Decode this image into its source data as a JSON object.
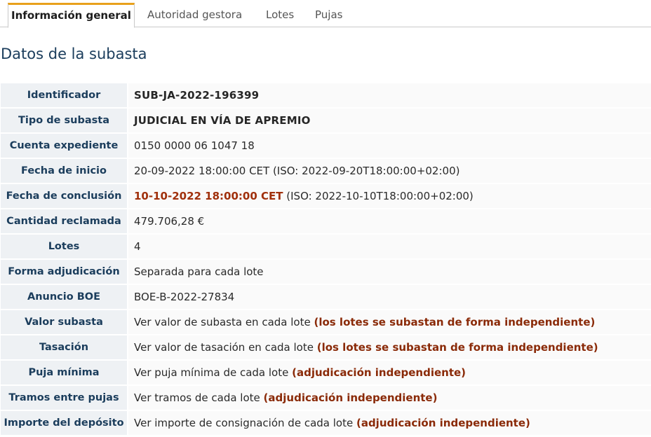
{
  "tabs": [
    {
      "label": "Información general",
      "active": true
    },
    {
      "label": "Autoridad gestora",
      "active": false
    },
    {
      "label": "Lotes",
      "active": false
    },
    {
      "label": "Pujas",
      "active": false
    }
  ],
  "section_title": "Datos de la subasta",
  "rows": {
    "identificador": {
      "label": "Identificador",
      "value": "SUB-JA-2022-196399"
    },
    "tipo": {
      "label": "Tipo de subasta",
      "value": "JUDICIAL EN VÍA DE APREMIO"
    },
    "cuenta": {
      "label": "Cuenta expediente",
      "value": "0150 0000 06 1047 18"
    },
    "inicio": {
      "label": "Fecha de inicio",
      "value": "20-09-2022 18:00:00 CET (ISO: 2022-09-20T18:00:00+02:00)"
    },
    "conclusion": {
      "label": "Fecha de conclusión",
      "date": "10-10-2022 18:00:00 CET",
      "iso": " (ISO: 2022-10-10T18:00:00+02:00)"
    },
    "cantidad": {
      "label": "Cantidad reclamada",
      "value": "479.706,28 €"
    },
    "lotes": {
      "label": "Lotes",
      "value": "4"
    },
    "forma": {
      "label": "Forma adjudicación",
      "value": "Separada para cada lote"
    },
    "anuncio": {
      "label": "Anuncio BOE",
      "value": "BOE-B-2022-27834"
    },
    "valor": {
      "label": "Valor subasta",
      "value": "Ver valor de subasta en cada lote ",
      "note": "(los lotes se subastan de forma independiente)"
    },
    "tasacion": {
      "label": "Tasación",
      "value": "Ver valor de tasación en cada lote ",
      "note": "(los lotes se subastan de forma independiente)"
    },
    "puja_minima": {
      "label": "Puja mínima",
      "value": "Ver puja mínima de cada lote ",
      "note": "(adjudicación independiente)"
    },
    "tramos": {
      "label": "Tramos entre pujas",
      "value": "Ver tramos de cada lote ",
      "note": "(adjudicación independiente)"
    },
    "deposito": {
      "label": "Importe del depósito",
      "value": "Ver importe de consignación de cada lote ",
      "note": "(adjudicación independiente)"
    }
  },
  "colors": {
    "accent": "#e8a11c",
    "label": "#1b3d5c",
    "highlight": "#a0300c"
  }
}
